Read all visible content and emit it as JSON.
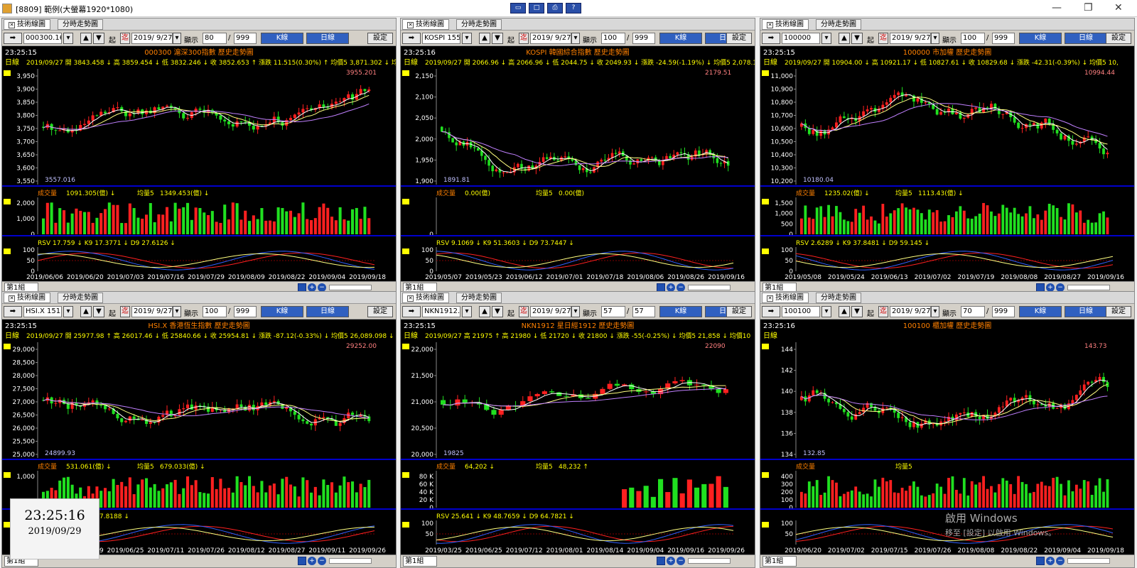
{
  "app": {
    "title": "[8809] 範例(大螢幕1920*1080)",
    "toolbar_icons": [
      "monitor-icon",
      "window-icon",
      "print-icon",
      "help-icon"
    ]
  },
  "common": {
    "tab_tech": "技術線圖",
    "tab_minute": "分時走勢圖",
    "btn_start": "起",
    "btn_end": "迄",
    "lbl_show": "顯示",
    "btn_kline": "K線",
    "btn_period": "日線",
    "btn_settings": "設定",
    "group": "第1組",
    "lbl_period": "日線",
    "lbl_vol": "成交量",
    "lbl_avg": "均量5"
  },
  "panels": [
    {
      "id": "p1",
      "symbol": "000300.16",
      "date": "2019/ 9/27",
      "show": "80",
      "max": "999",
      "time": "23:25:15",
      "name": "000300 滬深300指數 歷史走勢圖",
      "ohlc": "2019/09/27 開 3843.458 ↓ 高 3859.454 ↓ 低 3832.246 ↓ 收 3852.653 ↑ 漲跌 11.515(0.30%) ↑ 均價5 3,871.302 ↓ 均價",
      "yticks": [
        "3,950",
        "3,900",
        "3,850",
        "3,800",
        "3,750",
        "3,700",
        "3,650",
        "3,600",
        "3,550"
      ],
      "hi": "3955.201",
      "lo": "3557.016",
      "vol_text": "1091.305(億) ↓",
      "vol_avg": "1349.453(億) ↓",
      "vticks": [
        "2,000",
        "1,000",
        "0"
      ],
      "kd": "RSV 17.759 ↓ K9 17.3771 ↓ D9 27.6126 ↓",
      "kdticks": [
        "100",
        "50",
        "0"
      ],
      "dates": [
        "2019/06/06",
        "2019/06/20",
        "2019/07/03",
        "2019/07/16",
        "2019/07/29",
        "2019/08/09",
        "2019/08/22",
        "2019/09/04",
        "2019/09/18"
      ]
    },
    {
      "id": "p2",
      "symbol": "KOSPI 155",
      "date": "2019/ 9/27",
      "show": "100",
      "max": "999",
      "time": "23:25:16",
      "name": "KOSPI 韓國綜合指數 歷史走勢圖",
      "ohlc": "2019/09/27 開 2066.96 ↓ 高 2066.96 ↓ 低 2044.75 ↓ 收 2049.93 ↓ 漲跌 -24.59(-1.19%) ↓ 均價5 2,078.11",
      "yticks": [
        "2,150",
        "2,100",
        "2,050",
        "2,000",
        "1,950",
        "1,900"
      ],
      "hi": "2179.51",
      "lo": "1891.81",
      "vol_text": "0.00(億)",
      "vol_avg": "0.00(億)",
      "vticks": [
        "0"
      ],
      "kd": "RSV 9.1069 ↓ K9 51.3603 ↓ D9 73.7447 ↓",
      "kdticks": [
        "100",
        "50",
        "0"
      ],
      "dates": [
        "2019/05/07",
        "2019/05/23",
        "2019/06/12",
        "2019/07/01",
        "2019/07/18",
        "2019/08/06",
        "2019/08/26",
        "2019/09/16"
      ]
    },
    {
      "id": "p3",
      "symbol": "100000",
      "date": "2019/ 9/27",
      "show": "100",
      "max": "999",
      "time": "23:25:15",
      "name": "100000 市加權 歷史走勢圖",
      "ohlc": "2019/09/27 開 10904.00 ↓ 高 10921.17 ↓ 低 10827.61 ↓ 收 10829.68 ↓ 漲跌 -42.31(-0.39%) ↓ 均價5 10,",
      "yticks": [
        "11,000",
        "10,900",
        "10,800",
        "10,700",
        "10,600",
        "10,500",
        "10,400",
        "10,300",
        "10,200"
      ],
      "hi": "10994.44",
      "lo": "10180.04",
      "vol_text": "1235.02(億) ↓",
      "vol_avg": "1113.43(億) ↓",
      "vticks": [
        "1,500",
        "1,000",
        "500",
        "0"
      ],
      "kd": "RSV 2.6289 ↓ K9 37.8481 ↓ D9 59.145 ↓",
      "kdticks": [
        "100",
        "50",
        "0"
      ],
      "dates": [
        "2019/05/08",
        "2019/05/24",
        "2019/06/13",
        "2019/07/02",
        "2019/07/19",
        "2019/08/08",
        "2019/08/27",
        "2019/09/16"
      ]
    },
    {
      "id": "p4",
      "symbol": "HSI.X 151",
      "date": "2019/ 9/27",
      "show": "100",
      "max": "999",
      "time": "23:25:15",
      "name": "HSI.X 香港恆生指數 歷史走勢圖",
      "ohlc": "2019/09/27 開 25977.98 ↑ 高 26017.46 ↓ 低 25840.66 ↓ 收 25954.81 ↓ 漲跌 -87.12(-0.33%) ↓ 均價5 26,089.098 ↓ 均價",
      "yticks": [
        "29,000",
        "28,500",
        "28,000",
        "27,500",
        "27,000",
        "26,500",
        "26,000",
        "25,500",
        "25,000"
      ],
      "hi": "29252.00",
      "lo": "24899.93",
      "vol_text": "531.061(億) ↓",
      "vol_avg": "679.033(億) ↓",
      "vticks": [
        "1,000",
        "500"
      ],
      "kd": "RSV 0.8188 ↓ D9 17.8188 ↓",
      "kdticks": [
        "100",
        "50",
        "0"
      ],
      "dates": [
        "2019/05/08",
        "2019/05/29",
        "2019/06/25",
        "2019/07/11",
        "2019/07/26",
        "2019/08/12",
        "2019/08/27",
        "2019/09/11",
        "2019/09/26"
      ]
    },
    {
      "id": "p5",
      "symbol": "NKN1912.2",
      "date": "2019/ 9/27",
      "show": "57",
      "max": "57",
      "time": "23:25:15",
      "name": "NKN1912 星日經1912 歷史走勢圖",
      "ohlc": "2019/09/27 高 21975 ↑ 高 21980 ↓ 低 21720 ↓ 收 21800 ↓ 漲跌 -55(-0.25%) ↓ 均價5 21,858 ↓ 均價10",
      "yticks": [
        "22,000",
        "21,500",
        "21,000",
        "20,500",
        "20,000"
      ],
      "hi": "22090",
      "lo": "19825",
      "vol_text": "64,202 ↓",
      "vol_avg": "48,232 ↑",
      "vticks": [
        "80 K",
        "60 K",
        "40 K",
        "20 K",
        "0"
      ],
      "kd": "RSV 25.641 ↓ K9 48.7659 ↓ D9 64.7821 ↓",
      "kdticks": [
        "100",
        "50"
      ],
      "dates": [
        "2019/03/25",
        "2019/06/25",
        "2019/07/12",
        "2019/08/01",
        "2019/08/14",
        "2019/09/04",
        "2019/09/16",
        "2019/09/26"
      ]
    },
    {
      "id": "p6",
      "symbol": "100100",
      "date": "2019/ 9/27",
      "show": "70",
      "max": "999",
      "time": "23:25:16",
      "name": "100100 櫃加權 歷史走勢圖",
      "ohlc": "",
      "yticks": [
        "144",
        "142",
        "140",
        "138",
        "136",
        "134"
      ],
      "hi": "143.73",
      "lo": "132.85",
      "vol_text": "",
      "vol_avg": "",
      "vticks": [
        "400",
        "300",
        "200",
        "100",
        "0"
      ],
      "kd": "",
      "kdticks": [
        "100",
        "50"
      ],
      "dates": [
        "2019/06/20",
        "2019/07/02",
        "2019/07/15",
        "2019/07/26",
        "2019/08/08",
        "2019/08/22",
        "2019/09/04",
        "2019/09/18"
      ]
    }
  ],
  "clock": {
    "time": "23:25:16",
    "date": "2019/09/29"
  },
  "watermark": {
    "line1": "啟用 Windows",
    "line2": "移至 [設定] 以啟用 Windows。"
  },
  "colors": {
    "up": "#ff2020",
    "down": "#20e020",
    "axis": "#0000cc",
    "label_yellow": "#ffff00",
    "label_orange": "#ff8000"
  }
}
